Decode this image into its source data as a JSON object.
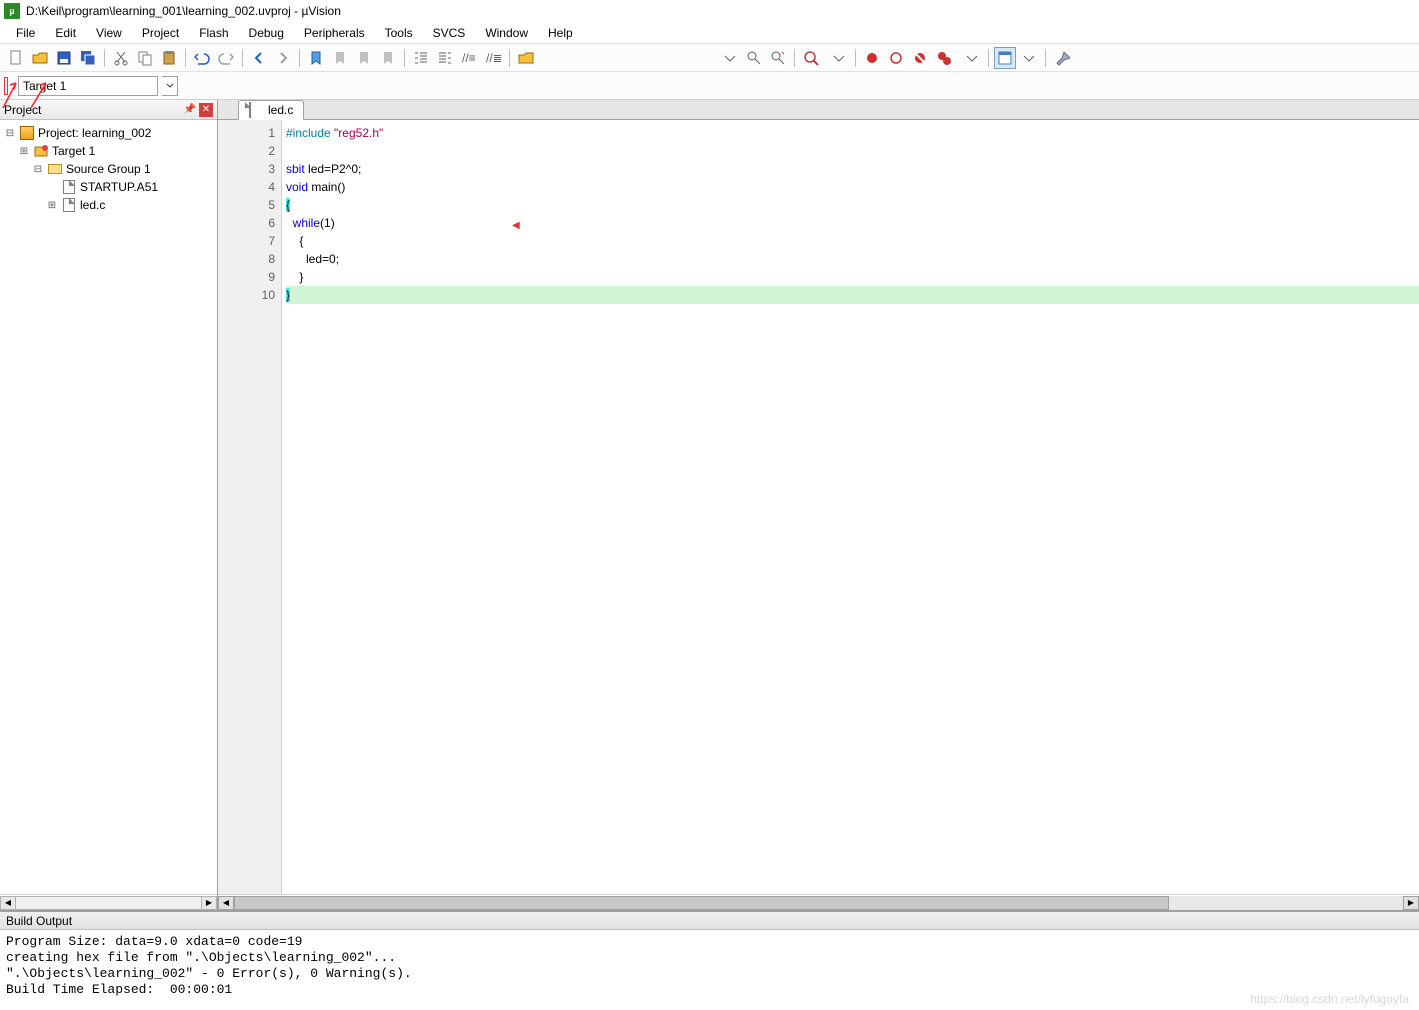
{
  "title": "D:\\Keil\\program\\learning_001\\learning_002.uvproj - µVision",
  "menu": [
    "File",
    "Edit",
    "View",
    "Project",
    "Flash",
    "Debug",
    "Peripherals",
    "Tools",
    "SVCS",
    "Window",
    "Help"
  ],
  "toolbar2": {
    "target_selected": "Target 1"
  },
  "project_panel": {
    "title": "Project",
    "tree": {
      "root": "Project: learning_002",
      "target": "Target 1",
      "group": "Source Group 1",
      "files": [
        "STARTUP.A51",
        "led.c"
      ]
    }
  },
  "editor": {
    "tab_label": "led.c",
    "lines": [
      {
        "n": 1,
        "segments": [
          {
            "t": "#include ",
            "c": "kw-pp"
          },
          {
            "t": "\"reg52.h\"",
            "c": "kw-str"
          }
        ]
      },
      {
        "n": 2,
        "segments": []
      },
      {
        "n": 3,
        "segments": [
          {
            "t": "sbit",
            "c": "kw-blue"
          },
          {
            "t": " led=P2^0;",
            "c": ""
          }
        ]
      },
      {
        "n": 4,
        "segments": [
          {
            "t": "void",
            "c": "kw-blue"
          },
          {
            "t": " main()",
            "c": ""
          }
        ]
      },
      {
        "n": 5,
        "segments": [
          {
            "t": "{",
            "c": "brace-hl"
          }
        ]
      },
      {
        "n": 6,
        "segments": [
          {
            "t": "  ",
            "c": ""
          },
          {
            "t": "while",
            "c": "kw-blue"
          },
          {
            "t": "(1)",
            "c": ""
          }
        ]
      },
      {
        "n": 7,
        "segments": [
          {
            "t": "    {",
            "c": ""
          }
        ]
      },
      {
        "n": 8,
        "segments": [
          {
            "t": "      led=0;",
            "c": ""
          }
        ]
      },
      {
        "n": 9,
        "segments": [
          {
            "t": "    }",
            "c": ""
          }
        ]
      },
      {
        "n": 10,
        "segments": [
          {
            "t": "}",
            "c": "brace-hl"
          }
        ],
        "hl": true
      }
    ]
  },
  "build_output": {
    "title": "Build Output",
    "lines": [
      "Program Size: data=9.0 xdata=0 code=19",
      "creating hex file from \".\\Objects\\learning_002\"...",
      "\".\\Objects\\learning_002\" - 0 Error(s), 0 Warning(s).",
      "Build Time Elapsed:  00:00:01"
    ]
  },
  "watermark": "https://blog.csdn.net/lyfugoyfa"
}
